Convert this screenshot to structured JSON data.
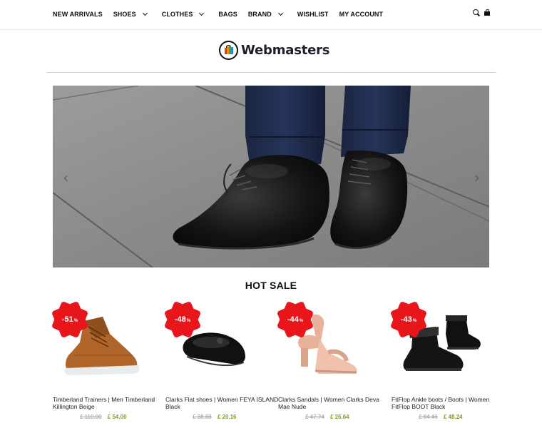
{
  "nav": {
    "items": [
      {
        "label": "NEW ARRIVALS",
        "dropdown": false
      },
      {
        "label": "SHOES",
        "dropdown": true
      },
      {
        "label": "CLOTHES",
        "dropdown": true
      },
      {
        "label": "BAGS",
        "dropdown": false
      },
      {
        "label": "BRAND",
        "dropdown": true
      },
      {
        "label": "WISHLIST",
        "dropdown": false
      },
      {
        "label": "MY ACCOUNT",
        "dropdown": false
      }
    ],
    "icons": [
      "search-icon",
      "shopping-bag-icon"
    ]
  },
  "logo": {
    "text": "Webmasters"
  },
  "hero": {
    "slider_arrows": [
      "chevron-left-icon",
      "chevron-right-icon"
    ]
  },
  "hot_sale": {
    "title": "HOT SALE",
    "products": [
      {
        "discount": "-51",
        "pct": "%",
        "name": "Timberland Trainers | Men Timberland Killington Beige",
        "old_price": "£ 110.00",
        "new_price": "£ 54.00"
      },
      {
        "discount": "-48",
        "pct": "%",
        "name": "Clarks Flat shoes | Women FEYA ISLAND Black",
        "old_price": "£ 38.88",
        "new_price": "£ 20.16"
      },
      {
        "discount": "-44",
        "pct": "%",
        "name": "Clarks Sandals | Women Clarks Deva Mae Nude",
        "old_price": "£ 47.74",
        "new_price": "£ 26.64"
      },
      {
        "discount": "-43",
        "pct": "%",
        "name": "FitFlop Ankle boots / Boots | Women FitFlop BOOT Black",
        "old_price": "£ 84.46",
        "new_price": "£ 48.24"
      }
    ]
  },
  "colors": {
    "accent_red": "#e8161a",
    "price_green": "#7ea12b",
    "old_price_grey": "#9a9a9a"
  }
}
